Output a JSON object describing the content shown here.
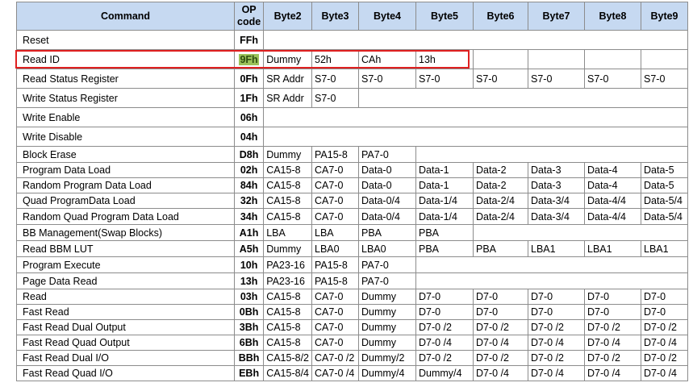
{
  "headers": [
    "Command",
    "OP code",
    "Byte2",
    "Byte3",
    "Byte4",
    "Byte5",
    "Byte6",
    "Byte7",
    "Byte8",
    "Byte9"
  ],
  "header_op_lines": [
    "OP",
    "code"
  ],
  "rows": [
    {
      "command": "Reset",
      "op": "FFh",
      "bytes": []
    },
    {
      "command": "Read ID",
      "op": "9Fh",
      "bytes": [
        "Dummy",
        "52h",
        "CAh",
        "13h"
      ],
      "highlighted": true
    },
    {
      "command": "Read Status Register",
      "op": "0Fh",
      "bytes": [
        "SR Addr",
        "S7-0",
        "S7-0",
        "S7-0",
        "S7-0",
        "S7-0",
        "S7-0",
        "S7-0"
      ]
    },
    {
      "command": "Write Status Register",
      "op": "1Fh",
      "bytes": [
        "SR Addr",
        "S7-0"
      ]
    },
    {
      "command": "Write Enable",
      "op": "06h",
      "bytes": []
    },
    {
      "command": "Write Disable",
      "op": "04h",
      "bytes": []
    },
    {
      "command": "Block Erase",
      "op": "D8h",
      "bytes": [
        "Dummy",
        "PA15-8",
        "PA7-0"
      ]
    },
    {
      "command": "Program Data Load",
      "op": "02h",
      "bytes": [
        "CA15-8",
        "CA7-0",
        "Data-0",
        "Data-1",
        "Data-2",
        "Data-3",
        "Data-4",
        "Data-5"
      ]
    },
    {
      "command": "Random Program Data Load",
      "op": "84h",
      "bytes": [
        "CA15-8",
        "CA7-0",
        "Data-0",
        "Data-1",
        "Data-2",
        "Data-3",
        "Data-4",
        "Data-5"
      ]
    },
    {
      "command": "Quad ProgramData Load",
      "op": "32h",
      "bytes": [
        "CA15-8",
        "CA7-0",
        "Data-0/4",
        "Data-1/4",
        "Data-2/4",
        "Data-3/4",
        "Data-4/4",
        "Data-5/4"
      ]
    },
    {
      "command": "Random Quad Program Data Load",
      "op": "34h",
      "bytes": [
        "CA15-8",
        "CA7-0",
        "Data-0/4",
        "Data-1/4",
        "Data-2/4",
        "Data-3/4",
        "Data-4/4",
        "Data-5/4"
      ]
    },
    {
      "command": "BB Management(Swap Blocks)",
      "op": "A1h",
      "bytes": [
        "LBA",
        "LBA",
        "PBA",
        "PBA"
      ]
    },
    {
      "command": "Read BBM LUT",
      "op": "A5h",
      "bytes": [
        "Dummy",
        "LBA0",
        "LBA0",
        "PBA",
        "PBA",
        "LBA1",
        "LBA1",
        "LBA1"
      ]
    },
    {
      "command": "Program Execute",
      "op": "10h",
      "bytes": [
        "PA23-16",
        "PA15-8",
        "PA7-0"
      ]
    },
    {
      "command": "Page Data Read",
      "op": "13h",
      "bytes": [
        "PA23-16",
        "PA15-8",
        "PA7-0"
      ]
    },
    {
      "command": "Read",
      "op": "03h",
      "bytes": [
        "CA15-8",
        "CA7-0",
        "Dummy",
        "D7-0",
        "D7-0",
        "D7-0",
        "D7-0",
        "D7-0"
      ]
    },
    {
      "command": "Fast Read",
      "op": "0Bh",
      "bytes": [
        "CA15-8",
        "CA7-0",
        "Dummy",
        "D7-0",
        "D7-0",
        "D7-0",
        "D7-0",
        "D7-0"
      ]
    },
    {
      "command": "Fast Read Dual Output",
      "op": "3Bh",
      "bytes": [
        "CA15-8",
        "CA7-0",
        "Dummy",
        "D7-0 /2",
        "D7-0 /2",
        "D7-0 /2",
        "D7-0 /2",
        "D7-0 /2"
      ]
    },
    {
      "command": "Fast Read Quad Output",
      "op": "6Bh",
      "bytes": [
        "CA15-8",
        "CA7-0",
        "Dummy",
        "D7-0 /4",
        "D7-0 /4",
        "D7-0 /4",
        "D7-0 /4",
        "D7-0 /4"
      ]
    },
    {
      "command": "Fast Read Dual I/O",
      "op": "BBh",
      "bytes": [
        "CA15-8/2",
        "CA7-0 /2",
        "Dummy/2",
        "D7-0 /2",
        "D7-0 /2",
        "D7-0 /2",
        "D7-0 /2",
        "D7-0 /2"
      ]
    },
    {
      "command": "Fast Read Quad I/O",
      "op": "EBh",
      "bytes": [
        "CA15-8/4",
        "CA7-0 /4",
        "Dummy/4",
        "Dummy/4",
        "D7-0 /4",
        "D7-0 /4",
        "D7-0 /4",
        "D7-0 /4"
      ]
    }
  ],
  "colors": {
    "header_bg": "#c6d9f1",
    "highlight_border": "#e02020",
    "op_highlight_bg": "#9cc25a"
  }
}
